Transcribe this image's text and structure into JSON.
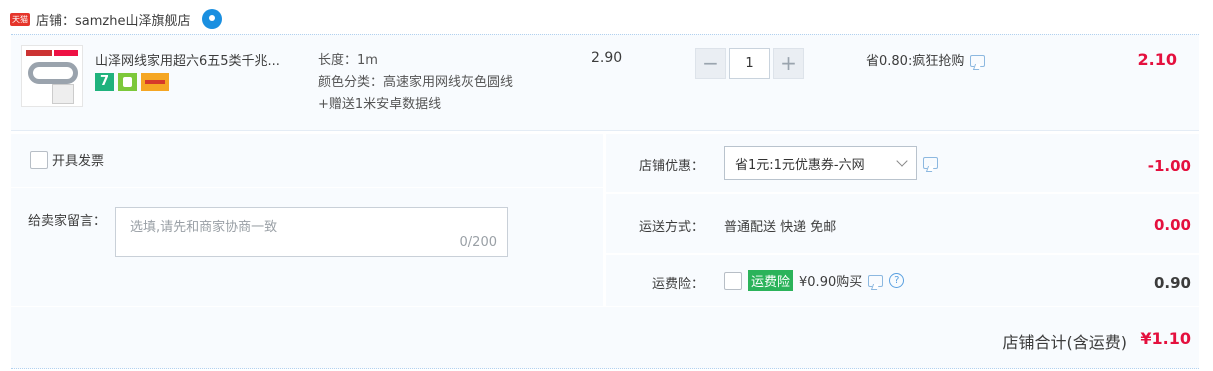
{
  "shop": {
    "badge": "天猫",
    "name": "店铺：samzhe山泽旗舰店",
    "badge_color": "#e5352b"
  },
  "item": {
    "title": "山泽网线家用超六6五5类千兆...",
    "sku_length": "长度：1m",
    "sku_color": "颜色分类：高速家用网线灰色圆线",
    "sku_gift": "+赠送1米安卓数据线",
    "badge_7": "7",
    "unit_price": "2.90",
    "qty_minus": "−",
    "quantity": "1",
    "qty_plus": "+",
    "promo": "省0.80:疯狂抢购",
    "total": "2.10"
  },
  "invoice": {
    "label": "开具发票"
  },
  "message": {
    "label": "给卖家留言：",
    "placeholder": "选填,请先和商家协商一致",
    "counter": "0/200"
  },
  "coupon": {
    "label": "店铺优惠：",
    "selected": "省1元:1元优惠券-六网",
    "amount": "-1.00"
  },
  "shipping": {
    "label": "运送方式：",
    "value": "普通配送 快递 免邮",
    "amount": "0.00"
  },
  "insurance": {
    "label": "运费险：",
    "tag": "运费险",
    "value": "¥0.90购买",
    "help": "?",
    "amount": "0.90"
  },
  "summary": {
    "label": "店铺合计(含运费)",
    "value": "¥1.10"
  },
  "colors": {
    "accent_red": "#e4103e",
    "panel_bg": "#f8fbfe",
    "insurance_green": "#2bb35a"
  }
}
